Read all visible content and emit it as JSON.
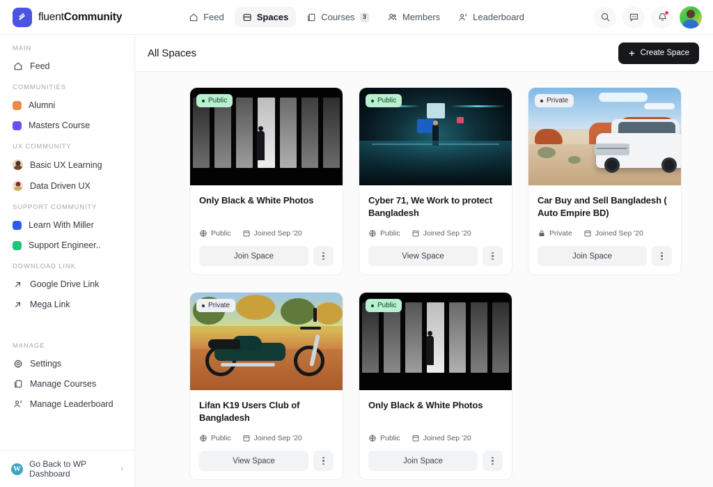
{
  "brand": {
    "light": "fluent",
    "bold": "Community",
    "logo_icon": "fluent-logo-icon"
  },
  "topnav": {
    "items": [
      {
        "label": "Feed",
        "icon": "home-icon",
        "active": false,
        "badge": ""
      },
      {
        "label": "Spaces",
        "icon": "spaces-icon",
        "active": true,
        "badge": ""
      },
      {
        "label": "Courses",
        "icon": "courses-icon",
        "active": false,
        "badge": "3"
      },
      {
        "label": "Members",
        "icon": "members-icon",
        "active": false,
        "badge": ""
      },
      {
        "label": "Leaderboard",
        "icon": "leaderboard-icon",
        "active": false,
        "badge": ""
      }
    ],
    "actions": [
      {
        "name": "search-icon"
      },
      {
        "name": "messages-icon"
      },
      {
        "name": "notifications-icon"
      }
    ],
    "avatar_alt": "user-avatar"
  },
  "sidebar": {
    "sections": [
      {
        "title": "MAIN",
        "items": [
          {
            "label": "Feed",
            "type": "icon",
            "icon": "home-icon"
          }
        ]
      },
      {
        "title": "COMMUNITIES",
        "items": [
          {
            "label": "Alumni",
            "type": "swatch",
            "color": "#f08a4b"
          },
          {
            "label": "Masters Course",
            "type": "swatch",
            "color": "#6d4cf0"
          }
        ]
      },
      {
        "title": "UX COMMUNITY",
        "items": [
          {
            "label": "Basic UX Learning",
            "type": "avatar",
            "color": "#e8d2b8",
            "hair": "#4a3322"
          },
          {
            "label": "Data Driven UX",
            "type": "avatar",
            "color": "#f6dcc4",
            "hair": "#7a2f2f"
          }
        ]
      },
      {
        "title": "SUPPORT COMMUNITY",
        "items": [
          {
            "label": "Learn With Miller",
            "type": "swatch",
            "color": "#2b5bea"
          },
          {
            "label": "Support Engineer..",
            "type": "swatch",
            "color": "#1fc47a"
          }
        ]
      },
      {
        "title": "DOWNLOAD LINK",
        "items": [
          {
            "label": "Google Drive Link",
            "type": "icon",
            "icon": "external-link-icon"
          },
          {
            "label": "Mega Link",
            "type": "icon",
            "icon": "external-link-icon"
          }
        ]
      },
      {
        "title": "MANAGE",
        "spacer_before": true,
        "items": [
          {
            "label": "Settings",
            "type": "icon",
            "icon": "gear-icon"
          },
          {
            "label": "Manage Courses",
            "type": "icon",
            "icon": "courses-icon"
          },
          {
            "label": "Manage Leaderboard",
            "type": "icon",
            "icon": "leaderboard-icon"
          }
        ]
      }
    ],
    "footer": {
      "label": "Go Back to WP Dashboard",
      "icon": "wordpress-icon",
      "chevron": "›",
      "mark": "W"
    }
  },
  "main": {
    "title": "All Spaces",
    "create_button": {
      "label": "Create Space",
      "icon": "plus-icon"
    }
  },
  "cards": [
    {
      "badge": "Public",
      "badge_type": "public",
      "title": "Only Black & White Photos",
      "privacy": "Public",
      "privacy_icon": "globe-icon",
      "joined": "Joined Sep '20",
      "joined_icon": "calendar-icon",
      "action": "Join Space",
      "art": "bw"
    },
    {
      "badge": "Public",
      "badge_type": "public",
      "title": "Cyber 71, We Work to protect Bangladesh",
      "privacy": "Public",
      "privacy_icon": "globe-icon",
      "joined": "Joined Sep '20",
      "joined_icon": "calendar-icon",
      "action": "View Space",
      "art": "cyber"
    },
    {
      "badge": "Private",
      "badge_type": "private",
      "title": "Car Buy and Sell Bangladesh ( Auto Empire BD)",
      "privacy": "Private",
      "privacy_icon": "lock-icon",
      "joined": "Joined Sep '20",
      "joined_icon": "calendar-icon",
      "action": "Join Space",
      "art": "car"
    },
    {
      "badge": "Private",
      "badge_type": "private",
      "title": "Lifan K19 Users Club of Bangladesh",
      "privacy": "Public",
      "privacy_icon": "globe-icon",
      "joined": "Joined Sep '20",
      "joined_icon": "calendar-icon",
      "action": "View Space",
      "art": "moto"
    },
    {
      "badge": "Public",
      "badge_type": "public",
      "title": "Only Black & White Photos",
      "privacy": "Public",
      "privacy_icon": "globe-icon",
      "joined": "Joined Sep '20",
      "joined_icon": "calendar-icon",
      "action": "Join Space",
      "art": "bw"
    }
  ],
  "colors": {
    "brand": "#4b53e0",
    "badge_public_bg": "#b8f0d0",
    "badge_private_bg": "#eef0f4",
    "create_button_bg": "#17181c",
    "notification_dot": "#f2385a"
  }
}
